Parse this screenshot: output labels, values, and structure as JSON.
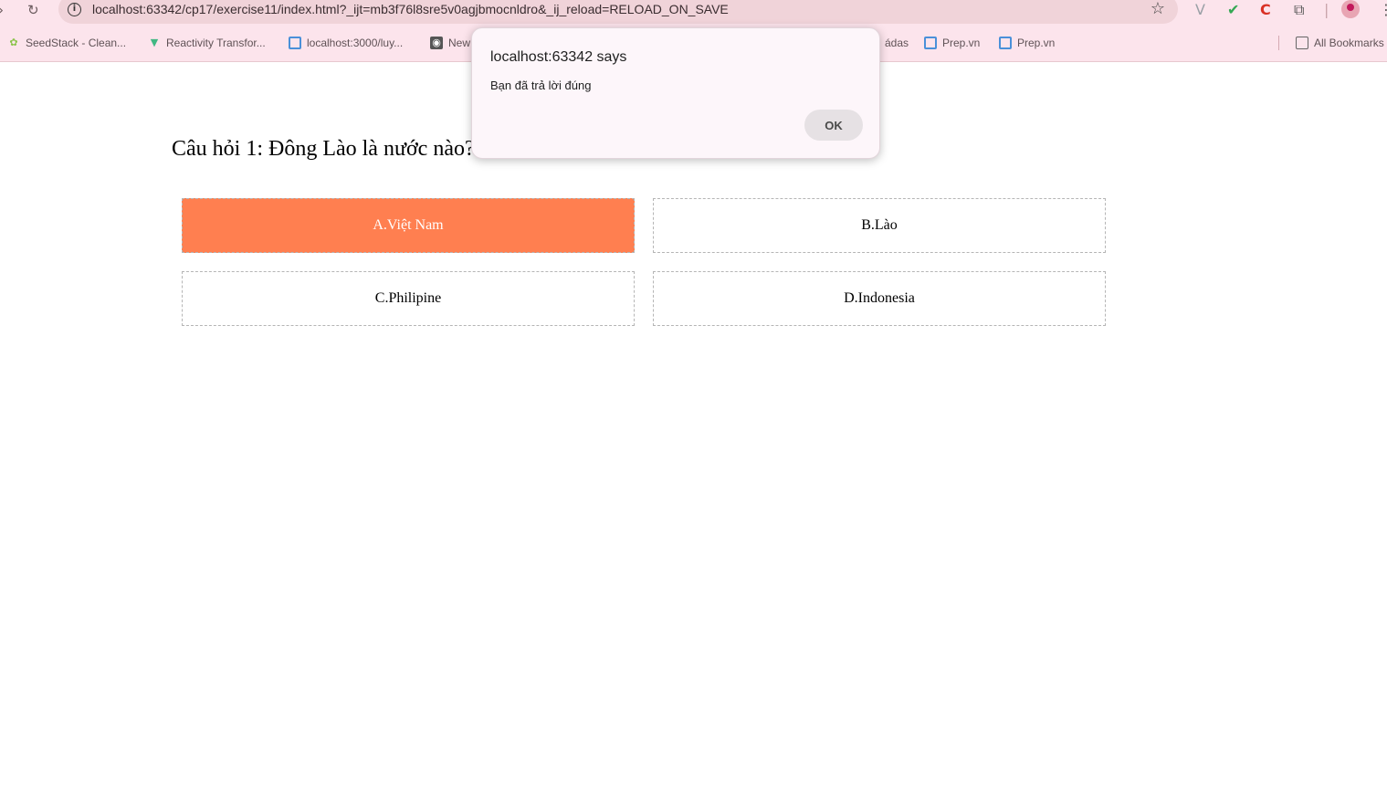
{
  "browser": {
    "url": "localhost:63342/cp17/exercise11/index.html?_ijt=mb3f76l8sre5v0agjbmocnldro&_ij_reload=RELOAD_ON_SAVE",
    "bookmarks": [
      {
        "label": "SeedStack - Clean...",
        "icon": "seed-icon"
      },
      {
        "label": "Reactivity Transfor...",
        "icon": "vue-icon"
      },
      {
        "label": "localhost:3000/luy...",
        "icon": "prep-icon"
      },
      {
        "label": "New",
        "icon": "globe-icon"
      },
      {
        "label": "ádas",
        "icon": "none"
      },
      {
        "label": "Prep.vn",
        "icon": "prep-icon"
      },
      {
        "label": "Prep.vn",
        "icon": "prep-icon"
      }
    ],
    "all_bookmarks_label": "All Bookmarks"
  },
  "quiz": {
    "question": "Câu hỏi 1: Đông Lào là nước nào?",
    "answers": [
      {
        "label": "A.Việt Nam",
        "selected": true
      },
      {
        "label": "B.Lào",
        "selected": false
      },
      {
        "label": "C.Philipine",
        "selected": false
      },
      {
        "label": "D.Indonesia",
        "selected": false
      }
    ],
    "selected_color": "#ff7f50"
  },
  "dialog": {
    "title": "localhost:63342 says",
    "message": "Bạn đã trả lời đúng",
    "ok_label": "OK"
  }
}
